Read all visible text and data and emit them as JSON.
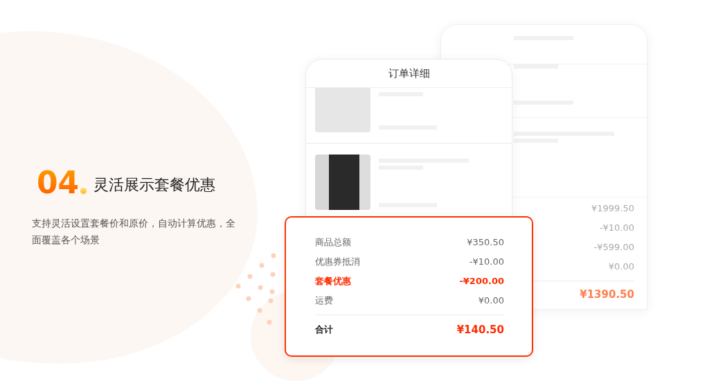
{
  "feature": {
    "number": "04",
    "title": "灵活展示套餐优惠",
    "description": "支持灵活设置套餐价和原价，自动计算优惠，全面覆盖各个场景"
  },
  "back_phone": {
    "amounts": [
      "¥1999.50",
      "-¥10.00",
      "-¥599.00",
      "¥0.00"
    ],
    "total": "¥1390.50"
  },
  "front_phone": {
    "title": "订单详细",
    "items": [
      {
        "kind": "light"
      },
      {
        "kind": "dark"
      }
    ]
  },
  "summary_card": {
    "rows": [
      {
        "label": "商品总额",
        "value": "¥350.50",
        "highlight": false
      },
      {
        "label": "优惠券抵消",
        "value": "-¥10.00",
        "highlight": false
      },
      {
        "label": "套餐优惠",
        "value": "-¥200.00",
        "highlight": true
      },
      {
        "label": "运费",
        "value": "¥0.00",
        "highlight": false
      }
    ],
    "total_label": "合计",
    "total_value": "¥140.50"
  }
}
